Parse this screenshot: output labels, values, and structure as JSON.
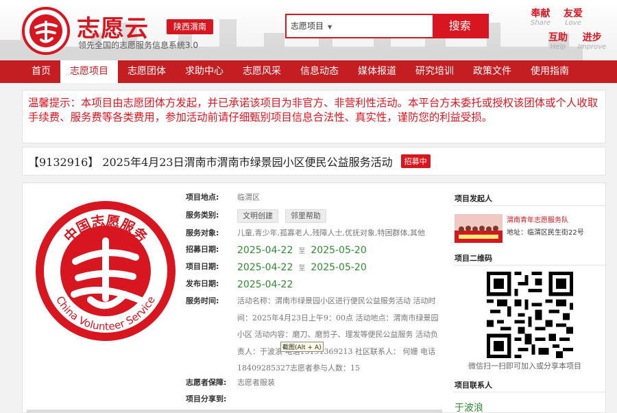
{
  "header": {
    "logo_text": "中国志愿服务",
    "brand": "志愿云",
    "region": "陕西渭南",
    "slogan": "领先全国的志愿服务信息系统3.0",
    "search": {
      "selected": "志愿项目",
      "button": "搜索"
    },
    "mottos": [
      {
        "cn": "奉献",
        "en": "Share"
      },
      {
        "cn": "友爱",
        "en": "Love"
      },
      {
        "cn": "互助",
        "en": "Help"
      },
      {
        "cn": "进步",
        "en": "Improve"
      }
    ]
  },
  "nav": {
    "items": [
      "首页",
      "志愿项目",
      "志愿团体",
      "求助中心",
      "志愿风采",
      "信息动态",
      "媒体报道",
      "研究培训",
      "政策文件",
      "使用指南"
    ],
    "active_index": 1
  },
  "notice": "温馨提示：本项目由志愿团体方发起，并已承诺该项目为非官方、非营利性活动。本平台方未委托或授权该团体或个人收取手续费、服务费等各类费用，参加活动前请仔细甄别项目信息合法性、真实性，谨防您的利益受损。",
  "project": {
    "title": "【9132916】 2025年4月23日渭南市渭南市绿景园小区便民公益服务活动",
    "status": "招募中",
    "logo_en": "China Volunteer Service",
    "labels": {
      "location": "项目地点:",
      "category": "服务类别:",
      "target": "服务对象:",
      "recruit": "招募日期:",
      "project_date": "项目日期:",
      "publish": "发布日期:",
      "service_time": "服务时间:",
      "insurance": "志愿者保障:",
      "share": "项目分享到:"
    },
    "location": "临渭区",
    "categories": [
      "文明创建",
      "邻里帮助"
    ],
    "target": "儿童,青少年,孤寡老人,残障人士,优抚对象,特困群体,其他",
    "recruit_start": "2025-04-22",
    "recruit_end": "2025-05-20",
    "project_start": "2025-04-22",
    "project_end": "2025-05-20",
    "date_sep": "至",
    "publish_date": "2025-04-22",
    "service_description": "活动名称：渭南市绿景园小区进行便民公益服务活动 活动时间：2025年4月23日上午9：00点 活动地点：渭南市绿景园小区 活动内容：磨刀、磨剪子、理发等便民公益服务 活动负责人：于波浪 电话15191369213 社区联系人： 何姗 电话18409285327志愿者参与人数：15",
    "insurance": "志愿者服装",
    "tooltip": "截图(Alt + A)"
  },
  "sidebar": {
    "sponsor_heading": "项目发起人",
    "org_name": "渭南青年志愿服务队",
    "org_address": "地址：临渭区民生街22号",
    "qr_heading": "项目二维码",
    "qr_caption": "微信扫一扫即可加入或分享本项目",
    "contact_heading": "项目联系人",
    "contact_name": "于波浪"
  },
  "colors": {
    "brand_red": "#d7161f",
    "nav_red": "#c41e23",
    "date_green": "#2e8b2e"
  }
}
